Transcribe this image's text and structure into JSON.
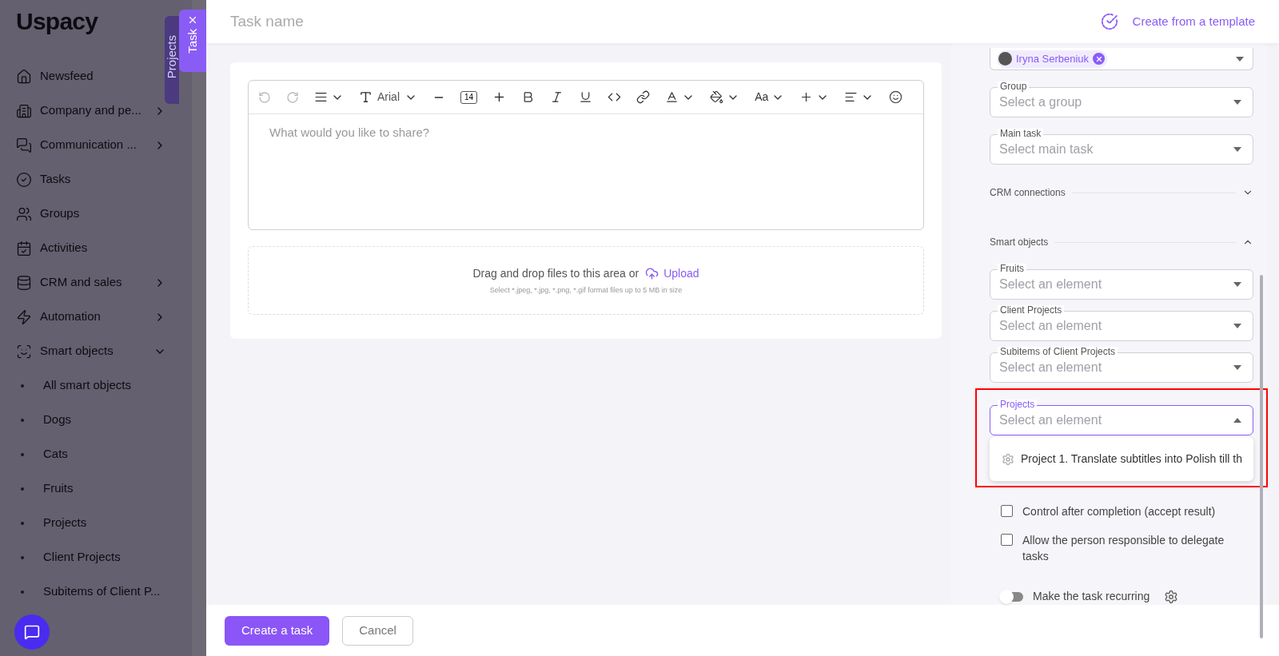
{
  "sidebar": {
    "logo": "Uspacy",
    "items": [
      {
        "label": "Newsfeed",
        "kind": "link"
      },
      {
        "label": "Company and pe...",
        "kind": "menu"
      },
      {
        "label": "Communication ...",
        "kind": "menu"
      },
      {
        "label": "Tasks",
        "kind": "link"
      },
      {
        "label": "Groups",
        "kind": "link"
      },
      {
        "label": "Activities",
        "kind": "link"
      },
      {
        "label": "CRM and sales",
        "kind": "menu"
      },
      {
        "label": "Automation",
        "kind": "menu"
      },
      {
        "label": "Smart objects",
        "kind": "group",
        "expanded": true
      },
      {
        "label": "All smart objects",
        "kind": "sub"
      },
      {
        "label": "Dogs",
        "kind": "sub"
      },
      {
        "label": "Cats",
        "kind": "sub"
      },
      {
        "label": "Fruits",
        "kind": "sub"
      },
      {
        "label": "Projects",
        "kind": "sub"
      },
      {
        "label": "Client Projects",
        "kind": "sub"
      },
      {
        "label": "Subitems of Client P...",
        "kind": "sub"
      }
    ]
  },
  "side_tabs": [
    {
      "label": "Projects",
      "selected": false
    },
    {
      "label": "Task",
      "selected": true
    }
  ],
  "header": {
    "placeholder": "Task name",
    "template_link": "Create from a template"
  },
  "editor": {
    "font": "Arial",
    "font_size": "14",
    "case_label": "Aa",
    "placeholder": "What would you like to share?"
  },
  "upload": {
    "text": "Drag and drop files to this area or",
    "link": "Upload",
    "hint": "Select *.jpeg, *.jpg, *.png, *.gif format files up to 5 MB in size"
  },
  "form": {
    "assignee_chip": "Iryna Serbeniuk",
    "fields": [
      {
        "label": "Group",
        "placeholder": "Select a group"
      },
      {
        "label": "Main task",
        "placeholder": "Select main task"
      }
    ],
    "sections": [
      {
        "title": "CRM connections",
        "expanded": false
      },
      {
        "title": "Smart objects",
        "expanded": true,
        "fields": [
          {
            "label": "Fruits",
            "placeholder": "Select an element",
            "open": false
          },
          {
            "label": "Client Projects",
            "placeholder": "Select an element",
            "open": false
          },
          {
            "label": "Subitems of Client Projects",
            "placeholder": "Select an element",
            "open": false
          },
          {
            "label": "Projects",
            "placeholder": "Select an element",
            "open": true,
            "highlighted": true,
            "options": [
              "Project 1. Translate subtitles into Polish till th"
            ]
          }
        ]
      }
    ],
    "checkboxes": [
      {
        "label": "Control after completion (accept result)",
        "checked": false
      },
      {
        "label": "Allow the person responsible to delegate tasks",
        "checked": false
      }
    ],
    "toggle": {
      "label": "Make the task recurring",
      "on": false
    }
  },
  "footer": {
    "buttons": [
      {
        "label": "Create a task",
        "kind": "primary"
      },
      {
        "label": "Cancel",
        "kind": "secondary"
      }
    ]
  }
}
